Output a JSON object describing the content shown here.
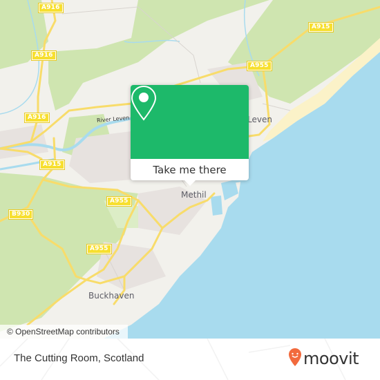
{
  "map": {
    "road_labels": [
      {
        "id": "a916-1",
        "text": "A916"
      },
      {
        "id": "a916-2",
        "text": "A916"
      },
      {
        "id": "a916-3",
        "text": "A916"
      },
      {
        "id": "a915-1",
        "text": "A915"
      },
      {
        "id": "a915-2",
        "text": "A915"
      },
      {
        "id": "a955-1",
        "text": "A955"
      },
      {
        "id": "a955-2",
        "text": "A955"
      },
      {
        "id": "a955-3",
        "text": "A955"
      },
      {
        "id": "b930",
        "text": "B930"
      }
    ],
    "place_labels": {
      "leven": "Leven",
      "methil": "Methil",
      "buckhaven": "Buckhaven",
      "river_leven": "River Leven"
    },
    "colors": {
      "land": "#f2f1ec",
      "green": "#cfe5b0",
      "water": "#a8dbee",
      "beach": "#fbf2c8",
      "road": "#f8dc6a",
      "urban": "#e7e2df"
    }
  },
  "popup": {
    "icon": "map-pin-icon",
    "button_label": "Take me there",
    "color": "#1db96a"
  },
  "attribution": "© OpenStreetMap contributors",
  "footer": {
    "title": "The Cutting Room, Scotland",
    "logo_text": "moovit",
    "logo_icon": "moovit-pin-icon",
    "logo_color": "#f26a3d"
  }
}
